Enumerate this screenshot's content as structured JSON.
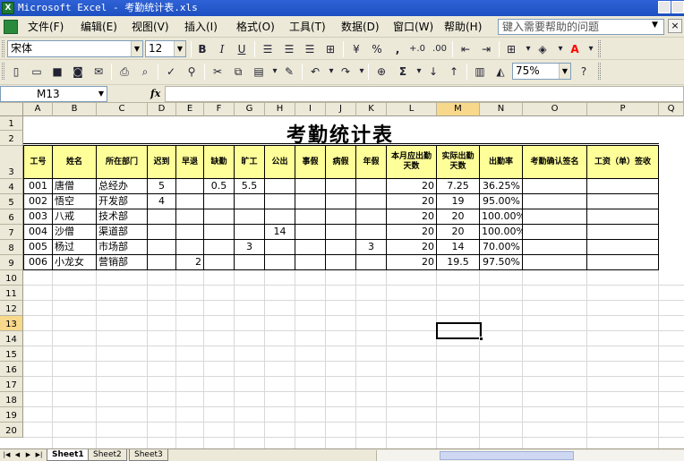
{
  "window": {
    "title": "Microsoft Excel - 考勤统计表.xls",
    "app_icon": "excel-icon"
  },
  "menu": {
    "items": [
      "文件(F)",
      "编辑(E)",
      "视图(V)",
      "插入(I)",
      "格式(O)",
      "工具(T)",
      "数据(D)",
      "窗口(W)",
      "帮助(H)"
    ],
    "help_placeholder": "键入需要帮助的问题",
    "close_glyph": "×"
  },
  "format_toolbar": {
    "font_name": "宋体",
    "font_size": "12",
    "bold": "B",
    "italic": "I",
    "underline": "U",
    "percent": "%",
    "comma": ",",
    "inc_decimal": "+.0",
    "dec_decimal": ".00",
    "font_color": "A",
    "fill_color_hex": "#ffff00",
    "font_color_hex": "#ff0000"
  },
  "standard_toolbar": {
    "zoom": "75%",
    "sigma": "Σ",
    "help": "?"
  },
  "formula_bar": {
    "name_box": "M13",
    "fx": "fx",
    "formula": ""
  },
  "grid": {
    "columns": [
      "A",
      "B",
      "C",
      "D",
      "E",
      "F",
      "G",
      "H",
      "I",
      "J",
      "K",
      "L",
      "M",
      "N",
      "O",
      "P",
      "Q"
    ],
    "rows": [
      "1",
      "2",
      "3",
      "4",
      "5",
      "6",
      "7",
      "8",
      "9",
      "10",
      "11",
      "12",
      "13",
      "14",
      "15",
      "16",
      "17",
      "18",
      "19",
      "20"
    ],
    "selected_column": "M",
    "selected_row": "13",
    "title": "考勤统计表",
    "table_header_fill": "#ffff99"
  },
  "table": {
    "headers": [
      "工号",
      "姓名",
      "所在部门",
      "迟到",
      "早退",
      "缺勤",
      "旷工",
      "公出",
      "事假",
      "病假",
      "年假",
      "本月应出勤天数",
      "实际出勤天数",
      "出勤率",
      "考勤确认签名",
      "工资（单）签收"
    ],
    "rows": [
      [
        "001",
        "唐僧",
        "总经办",
        "5",
        "",
        "0.5",
        "5.5",
        "",
        "",
        "",
        "",
        "20",
        "7.25",
        "36.25%",
        "",
        ""
      ],
      [
        "002",
        "悟空",
        "开发部",
        "4",
        "",
        "",
        "",
        "",
        "",
        "",
        "",
        "20",
        "19",
        "95.00%",
        "",
        ""
      ],
      [
        "003",
        "八戒",
        "技术部",
        "",
        "",
        "",
        "",
        "",
        "",
        "",
        "",
        "20",
        "20",
        "100.00%",
        "",
        ""
      ],
      [
        "004",
        "沙僧",
        "渠道部",
        "",
        "",
        "",
        "",
        "14",
        "",
        "",
        "",
        "20",
        "20",
        "100.00%",
        "",
        ""
      ],
      [
        "005",
        "杨过",
        "市场部",
        "",
        "",
        "",
        "3",
        "",
        "",
        "",
        "3",
        "20",
        "14",
        "70.00%",
        "",
        ""
      ],
      [
        "006",
        "小龙女",
        "营销部",
        "",
        "2",
        "",
        "",
        "",
        "",
        "",
        "",
        "20",
        "19.5",
        "97.50%",
        "",
        ""
      ]
    ]
  },
  "sheet_tabs": [
    "Sheet1",
    "Sheet2",
    "Sheet3"
  ],
  "active_sheet": "Sheet1"
}
